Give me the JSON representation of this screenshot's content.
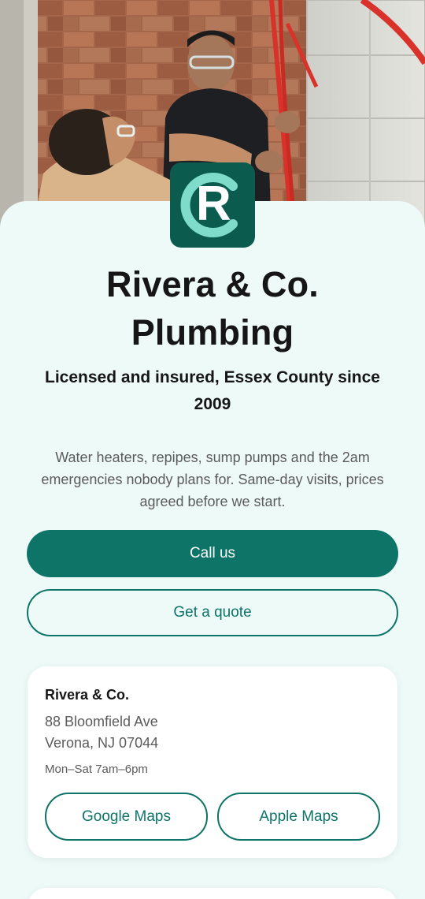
{
  "hero": {
    "image_name": "plumbers-working-photo"
  },
  "brand": {
    "logo_letters": "R",
    "title_line1": "Rivera & Co.",
    "title_line2": "Plumbing",
    "tagline": "Licensed and insured, Essex County since 2009",
    "description": "Water heaters, repipes, sump pumps and the 2am emergencies nobody plans for. Same-day visits, prices agreed before we start.",
    "primary_color": "#0e7468",
    "logo_bg": "#0b5c4f",
    "logo_accent": "#7fdccb"
  },
  "actions": {
    "call_label": "Call us",
    "quote_label": "Get a quote"
  },
  "location": {
    "name": "Rivera & Co.",
    "address_line1": "88 Bloomfield Ave",
    "address_line2": "Verona, NJ 07044",
    "hours": "Mon–Sat 7am–6pm",
    "google_maps_label": "Google Maps",
    "apple_maps_label": "Apple Maps"
  }
}
